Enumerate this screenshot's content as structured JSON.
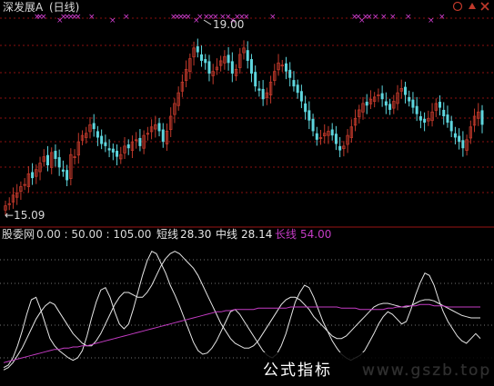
{
  "colors": {
    "background": "#000000",
    "grid": "#8a1111",
    "up_candle": "#c0392b",
    "down_candle": "#5ed6de",
    "marker": "#d23fd2",
    "white_line": "#e6e6e6",
    "long_line": "#c53cc5",
    "watermark_text": "#ffffff",
    "watermark_site": "#333333",
    "panel_text": "#d9d9d9",
    "value_white": "#e6e6e6",
    "value_magenta": "#c53cc5"
  },
  "header": {
    "title": "深发展A",
    "period": "(日线)"
  },
  "window_controls": {
    "icons": [
      "circle-icon",
      "up-arrow-icon",
      "close-icon"
    ]
  },
  "price_panel": {
    "high_label": "19.00",
    "low_label": "←15.09"
  },
  "indicator_panel": {
    "name": "股委网",
    "levels": "0.00 : 50.00 : 105.00",
    "short_label": "短线",
    "short_value": "28.30",
    "mid_label": "中线",
    "mid_value": "28.14",
    "long_label": "长线",
    "long_value": "54.00"
  },
  "watermark": {
    "cn": "公式指标",
    "site": "www.gszb.top"
  },
  "chart_data": [
    {
      "type": "candlestick",
      "title": "深发展A (日线)",
      "ylim": [
        15.0,
        19.6
      ],
      "labels": {
        "high": "19.00",
        "low": "15.09"
      },
      "close": [
        15.2,
        15.25,
        15.45,
        15.5,
        15.65,
        15.7,
        15.95,
        15.85,
        16.05,
        16.2,
        16.35,
        16.15,
        16.45,
        16.3,
        16.1,
        16.0,
        15.8,
        16.4,
        16.35,
        16.7,
        16.85,
        16.9,
        17.1,
        17.0,
        16.8,
        16.65,
        16.6,
        16.5,
        16.45,
        16.35,
        16.4,
        16.6,
        16.55,
        16.7,
        16.75,
        16.6,
        16.85,
        16.9,
        17.05,
        17.1,
        16.95,
        16.7,
        16.95,
        17.3,
        17.6,
        17.85,
        18.1,
        18.4,
        18.65,
        18.9,
        18.8,
        18.6,
        18.55,
        18.3,
        18.35,
        18.45,
        18.6,
        18.7,
        18.55,
        18.3,
        18.4,
        18.75,
        18.9,
        18.6,
        18.3,
        18.0,
        17.9,
        17.7,
        17.85,
        18.1,
        18.35,
        18.55,
        18.5,
        18.35,
        18.2,
        18.0,
        17.85,
        17.65,
        17.4,
        17.2,
        16.95,
        16.75,
        16.8,
        16.9,
        16.95,
        16.85,
        16.65,
        16.5,
        16.6,
        16.85,
        17.05,
        17.25,
        17.45,
        17.6,
        17.55,
        17.7,
        17.75,
        17.8,
        17.7,
        17.55,
        17.45,
        17.65,
        17.85,
        17.95,
        17.8,
        17.65,
        17.5,
        17.35,
        17.2,
        17.15,
        17.25,
        17.4,
        17.6,
        17.5,
        17.3,
        17.15,
        16.95,
        16.8,
        16.7,
        16.55,
        16.75,
        17.05,
        17.3,
        17.4,
        17.1
      ]
    },
    {
      "type": "line",
      "title": "股委网",
      "ylim": [
        0,
        105
      ],
      "series": [
        {
          "name": "短线",
          "values": [
            4,
            6,
            12,
            22,
            34,
            48,
            60,
            62,
            52,
            40,
            28,
            22,
            18,
            15,
            12,
            10,
            12,
            18,
            30,
            45,
            58,
            68,
            70,
            62,
            50,
            40,
            36,
            40,
            52,
            66,
            80,
            92,
            100,
            98,
            90,
            82,
            72,
            64,
            55,
            45,
            35,
            25,
            18,
            15,
            16,
            20,
            26,
            34,
            42,
            50,
            52,
            48,
            42,
            36,
            30,
            24,
            18,
            14,
            12,
            15,
            22,
            32,
            45,
            58,
            66,
            72,
            70,
            62,
            52,
            42,
            34,
            26,
            20,
            15,
            12,
            10,
            12,
            14,
            18,
            25,
            32,
            40,
            46,
            50,
            48,
            44,
            40,
            42,
            52,
            64,
            74,
            82,
            80,
            72,
            60,
            50,
            42,
            36,
            30,
            26,
            24,
            28,
            32,
            28
          ]
        },
        {
          "name": "中线",
          "values": [
            2,
            4,
            8,
            14,
            20,
            28,
            36,
            44,
            50,
            55,
            58,
            56,
            50,
            44,
            38,
            32,
            28,
            24,
            22,
            22,
            26,
            32,
            40,
            48,
            56,
            62,
            66,
            66,
            64,
            62,
            62,
            66,
            72,
            80,
            88,
            94,
            98,
            100,
            98,
            94,
            90,
            86,
            80,
            72,
            64,
            56,
            48,
            40,
            34,
            28,
            24,
            22,
            20,
            20,
            22,
            26,
            32,
            38,
            44,
            50,
            56,
            60,
            62,
            62,
            60,
            56,
            52,
            46,
            42,
            38,
            34,
            30,
            28,
            28,
            30,
            34,
            38,
            42,
            46,
            50,
            54,
            56,
            57,
            57,
            56,
            55,
            54,
            54,
            55,
            57,
            59,
            60,
            60,
            59,
            57,
            55,
            53,
            51,
            49,
            47,
            46,
            45,
            45,
            45
          ]
        },
        {
          "name": "长线",
          "values": [
            8,
            9,
            10,
            11,
            12,
            13,
            14,
            15,
            16,
            17,
            18,
            19,
            19,
            20,
            20,
            21,
            21,
            22,
            22,
            23,
            24,
            25,
            26,
            27,
            28,
            29,
            30,
            31,
            32,
            33,
            34,
            35,
            36,
            37,
            38,
            39,
            40,
            41,
            42,
            43,
            44,
            45,
            46,
            47,
            48,
            49,
            50,
            50,
            51,
            51,
            52,
            52,
            52,
            52,
            52,
            53,
            53,
            53,
            53,
            53,
            53,
            53,
            54,
            54,
            54,
            54,
            54,
            54,
            54,
            54,
            54,
            54,
            54,
            53,
            53,
            53,
            53,
            52,
            52,
            52,
            52,
            52,
            52,
            53,
            53,
            54,
            54,
            55,
            55,
            55,
            56,
            56,
            56,
            55,
            55,
            55,
            54,
            54,
            54,
            54,
            54,
            54,
            54,
            54
          ]
        }
      ]
    }
  ]
}
